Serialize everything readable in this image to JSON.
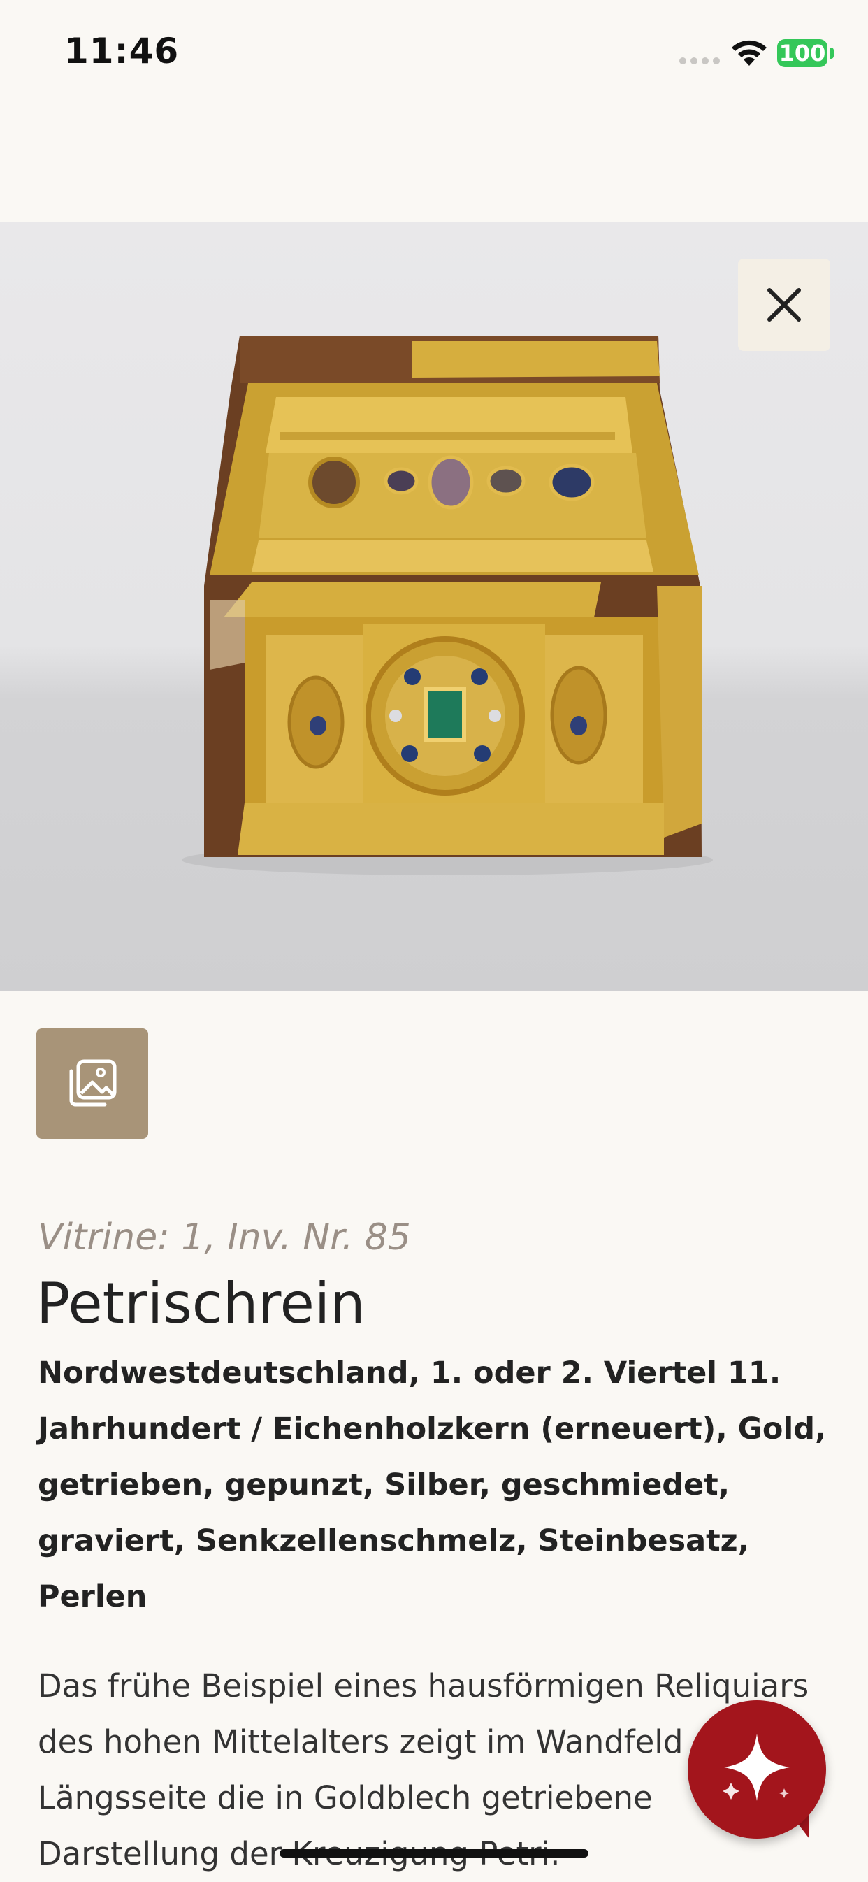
{
  "status_bar": {
    "time": "11:46",
    "battery": "100",
    "battery_color": "#34c759"
  },
  "hero": {
    "image_alt": "Petrischrein reliquary photograph",
    "close_icon": "close-icon"
  },
  "gallery_button": {
    "icon": "gallery-icon"
  },
  "object": {
    "meta": "Vitrine: 1, Inv. Nr. 85",
    "title": "Petrischrein",
    "subtitle": "Nordwestdeutschland, 1. oder 2. Viertel 11. Jahrhundert / Eichenholzkern (erneuert), Gold, getrieben, gepunzt, Silber, geschmiedet, graviert, Senkzellenschmelz, Steinbesatz, Perlen",
    "description": "Das frühe Beispiel eines hausförmigen Reliquiars des hohen Mittelalters zeigt im Wandfeld einer Längsseite die in Goldblech getriebene Darstellung der Kreuzigung Petri."
  },
  "fab": {
    "icon": "sparkle-icon",
    "color": "#a3151c"
  },
  "colors": {
    "background": "#faf8f4",
    "accent_brown": "#a89478",
    "close_bg": "#f4efe5"
  }
}
